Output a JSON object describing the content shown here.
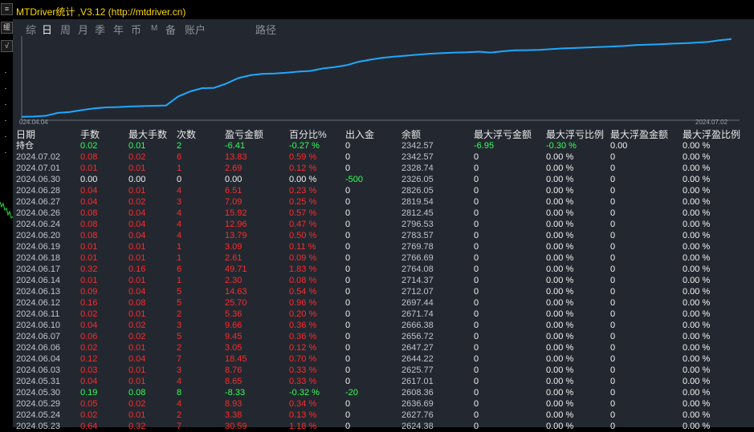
{
  "window": {
    "title": "MTDriver统计 ,V3.12 (http://mtdriver.cn)"
  },
  "left_strip": {
    "buttons": [
      "≡",
      "缓",
      "√"
    ]
  },
  "tabs": [
    {
      "label": "综",
      "active": false
    },
    {
      "label": "日",
      "active": true
    },
    {
      "label": "周",
      "active": false
    },
    {
      "label": "月",
      "active": false
    },
    {
      "label": "季",
      "active": false
    },
    {
      "label": "年",
      "active": false
    },
    {
      "label": "币",
      "active": false
    },
    {
      "label": "M",
      "active": false
    },
    {
      "label": "备",
      "active": false
    },
    {
      "label": "账户",
      "active": false
    },
    {
      "label": "路径",
      "active": false
    }
  ],
  "chart": {
    "start_label": "024.04.04",
    "end_label": "2024.07.02",
    "line_color": "#1fa8ff",
    "chart_data": {
      "type": "line",
      "title": "",
      "xlabel": "",
      "ylabel": "",
      "x_range": [
        "2024.04.04",
        "2024.07.02"
      ],
      "grid": false,
      "series": [
        {
          "values": [
            1878,
            1880,
            1885,
            1905,
            1912,
            1925,
            1937,
            1944,
            1946,
            1950,
            1953,
            1955,
            1957,
            2020,
            2055,
            2078,
            2080,
            2110,
            2148,
            2168,
            2178,
            2180,
            2185,
            2193,
            2198,
            2215,
            2225,
            2238,
            2262,
            2277,
            2290,
            2298,
            2305,
            2312,
            2318,
            2322,
            2326,
            2328,
            2332,
            2326,
            2335,
            2342,
            2343,
            2345,
            2350,
            2355,
            2358,
            2362,
            2365,
            2368,
            2372,
            2378,
            2381,
            2384,
            2388,
            2391,
            2395,
            2400,
            2412,
            2420
          ]
        }
      ]
    }
  },
  "table": {
    "columns": [
      "日期",
      "手数",
      "最大手数",
      "次数",
      "盈亏金额",
      "百分比%",
      "出入金",
      "余额",
      "最大浮亏金额",
      "最大浮亏比例",
      "最大浮盈金额",
      "最大浮盈比例"
    ],
    "holding_row": [
      "持仓",
      "0.02",
      "0.01",
      "2",
      "-6.41",
      "-0.27 %",
      "0",
      "2342.57",
      "-6.95",
      "-0.30 %",
      "0.00",
      "0.00 %"
    ],
    "rows": [
      [
        "2024.07.02",
        "0.08",
        "0.02",
        "6",
        "13.83",
        "0.59 %",
        "0",
        "2342.57",
        "0",
        "0.00 %",
        "0",
        "0.00 %"
      ],
      [
        "2024.07.01",
        "0.01",
        "0.01",
        "1",
        "2.69",
        "0.12 %",
        "0",
        "2328.74",
        "0",
        "0.00 %",
        "0",
        "0.00 %"
      ],
      [
        "2024.06.30",
        "0.00",
        "0.00",
        "0",
        "0.00",
        "0.00 %",
        "-500",
        "2326.05",
        "0",
        "0.00 %",
        "0",
        "0.00 %"
      ],
      [
        "2024.06.28",
        "0.04",
        "0.01",
        "4",
        "6.51",
        "0.23 %",
        "0",
        "2826.05",
        "0",
        "0.00 %",
        "0",
        "0.00 %"
      ],
      [
        "2024.06.27",
        "0.04",
        "0.02",
        "3",
        "7.09",
        "0.25 %",
        "0",
        "2819.54",
        "0",
        "0.00 %",
        "0",
        "0.00 %"
      ],
      [
        "2024.06.26",
        "0.08",
        "0.04",
        "4",
        "15.92",
        "0.57 %",
        "0",
        "2812.45",
        "0",
        "0.00 %",
        "0",
        "0.00 %"
      ],
      [
        "2024.06.24",
        "0.08",
        "0.04",
        "4",
        "12.96",
        "0.47 %",
        "0",
        "2796.53",
        "0",
        "0.00 %",
        "0",
        "0.00 %"
      ],
      [
        "2024.06.20",
        "0.08",
        "0.04",
        "4",
        "13.79",
        "0.50 %",
        "0",
        "2783.57",
        "0",
        "0.00 %",
        "0",
        "0.00 %"
      ],
      [
        "2024.06.19",
        "0.01",
        "0.01",
        "1",
        "3.09",
        "0.11 %",
        "0",
        "2769.78",
        "0",
        "0.00 %",
        "0",
        "0.00 %"
      ],
      [
        "2024.06.18",
        "0.01",
        "0.01",
        "1",
        "2.61",
        "0.09 %",
        "0",
        "2766.69",
        "0",
        "0.00 %",
        "0",
        "0.00 %"
      ],
      [
        "2024.06.17",
        "0.32",
        "0.16",
        "6",
        "49.71",
        "1.83 %",
        "0",
        "2764.08",
        "0",
        "0.00 %",
        "0",
        "0.00 %"
      ],
      [
        "2024.06.14",
        "0.01",
        "0.01",
        "1",
        "2.30",
        "0.08 %",
        "0",
        "2714.37",
        "0",
        "0.00 %",
        "0",
        "0.00 %"
      ],
      [
        "2024.06.13",
        "0.09",
        "0.04",
        "5",
        "14.63",
        "0.54 %",
        "0",
        "2712.07",
        "0",
        "0.00 %",
        "0",
        "0.00 %"
      ],
      [
        "2024.06.12",
        "0.16",
        "0.08",
        "5",
        "25.70",
        "0.96 %",
        "0",
        "2697.44",
        "0",
        "0.00 %",
        "0",
        "0.00 %"
      ],
      [
        "2024.06.11",
        "0.02",
        "0.01",
        "2",
        "5.36",
        "0.20 %",
        "0",
        "2671.74",
        "0",
        "0.00 %",
        "0",
        "0.00 %"
      ],
      [
        "2024.06.10",
        "0.04",
        "0.02",
        "3",
        "9.66",
        "0.36 %",
        "0",
        "2666.38",
        "0",
        "0.00 %",
        "0",
        "0.00 %"
      ],
      [
        "2024.06.07",
        "0.06",
        "0.02",
        "5",
        "9.45",
        "0.36 %",
        "0",
        "2656.72",
        "0",
        "0.00 %",
        "0",
        "0.00 %"
      ],
      [
        "2024.06.06",
        "0.02",
        "0.01",
        "2",
        "3.05",
        "0.12 %",
        "0",
        "2647.27",
        "0",
        "0.00 %",
        "0",
        "0.00 %"
      ],
      [
        "2024.06.04",
        "0.12",
        "0.04",
        "7",
        "18.45",
        "0.70 %",
        "0",
        "2644.22",
        "0",
        "0.00 %",
        "0",
        "0.00 %"
      ],
      [
        "2024.06.03",
        "0.03",
        "0.01",
        "3",
        "8.76",
        "0.33 %",
        "0",
        "2625.77",
        "0",
        "0.00 %",
        "0",
        "0.00 %"
      ],
      [
        "2024.05.31",
        "0.04",
        "0.01",
        "4",
        "8.65",
        "0.33 %",
        "0",
        "2617.01",
        "0",
        "0.00 %",
        "0",
        "0.00 %"
      ],
      [
        "2024.05.30",
        "0.19",
        "0.08",
        "8",
        "-8.33",
        "-0.32 %",
        "-20",
        "2608.36",
        "0",
        "0.00 %",
        "0",
        "0.00 %"
      ],
      [
        "2024.05.29",
        "0.05",
        "0.02",
        "4",
        "8.93",
        "0.34 %",
        "0",
        "2636.69",
        "0",
        "0.00 %",
        "0",
        "0.00 %"
      ],
      [
        "2024.05.24",
        "0.02",
        "0.01",
        "2",
        "3.38",
        "0.13 %",
        "0",
        "2627.76",
        "0",
        "0.00 %",
        "0",
        "0.00 %"
      ],
      [
        "2024.05.23",
        "0.64",
        "0.32",
        "7",
        "30.59",
        "1.18 %",
        "0",
        "2624.38",
        "0",
        "0.00 %",
        "0",
        "0.00 %"
      ]
    ],
    "colors": {
      "positive": "#ff2a2a",
      "negative": "#33ff55",
      "neutral": "#f2f2f2",
      "muted": "#c0c4cc"
    }
  }
}
